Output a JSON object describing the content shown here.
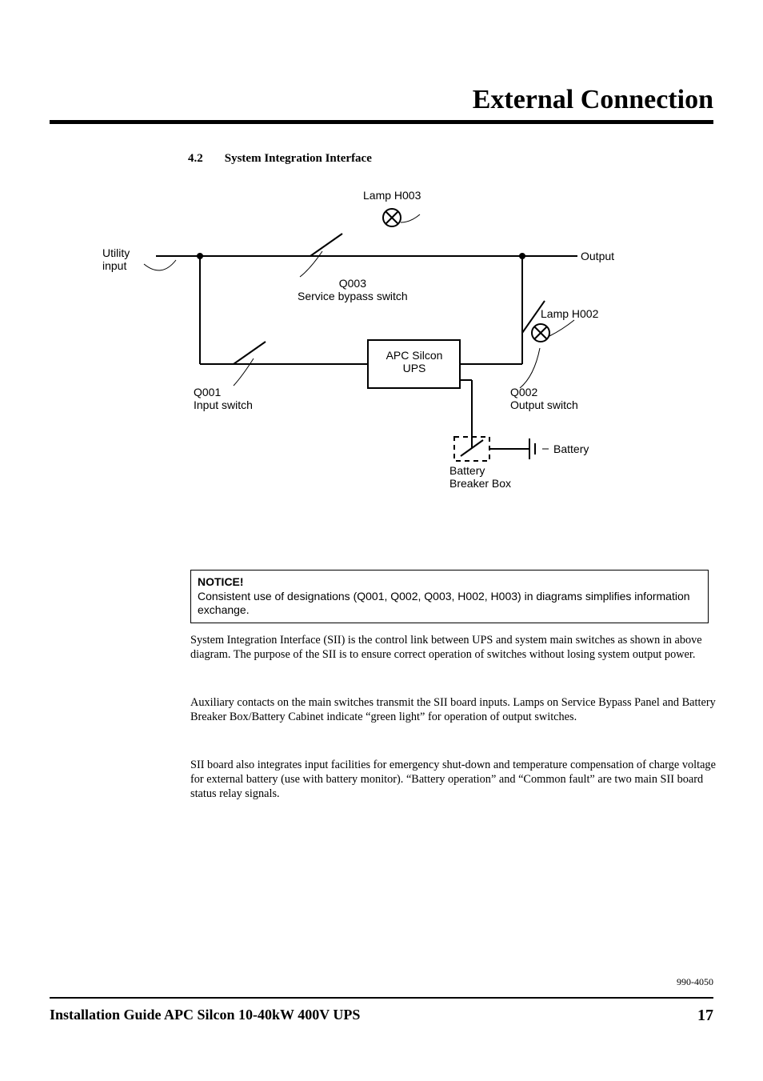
{
  "chapter_title": "External Connection",
  "section": {
    "num": "4.2",
    "title": "System Integration Interface"
  },
  "diagram": {
    "utility_input": "Utility\ninput",
    "output": "Output",
    "lamp_h003": "Lamp H003",
    "q003_top": "Q003",
    "q003_bottom": "Service bypass switch",
    "q001_top": "Q001",
    "q001_bottom": "Input switch",
    "q002_top": "Q002",
    "q002_bottom": "Output switch",
    "lamp_h002": "Lamp H002",
    "ups_top": "APC Silcon",
    "ups_bottom": "UPS",
    "battery_breaker_top": "Battery",
    "battery_breaker_bottom": "Breaker Box",
    "battery": "Battery"
  },
  "notice": {
    "title": "NOTICE!",
    "body": "Consistent use of designations (Q001, Q002, Q003, H002, H003) in diagrams simplifies information exchange."
  },
  "paragraphs": {
    "p1": "System Integration Interface (SII) is the control link between UPS and system main switches as shown in above diagram. The purpose of the SII is to ensure correct operation of switches without losing system output power.",
    "p2": "Auxiliary contacts on the main switches transmit the SII board inputs. Lamps on Service Bypass Panel and Battery Breaker Box/Battery Cabinet indicate “green light” for operation of output switches.",
    "p3": "SII board also integrates input facilities for emergency shut-down and temperature compensation of charge voltage for external battery (use with battery monitor). “Battery operation” and “Common fault” are two main SII board status relay signals."
  },
  "doc_number": "990-4050",
  "footer": {
    "title": "Installation Guide APC Silcon 10-40kW 400V UPS",
    "page": "17"
  }
}
